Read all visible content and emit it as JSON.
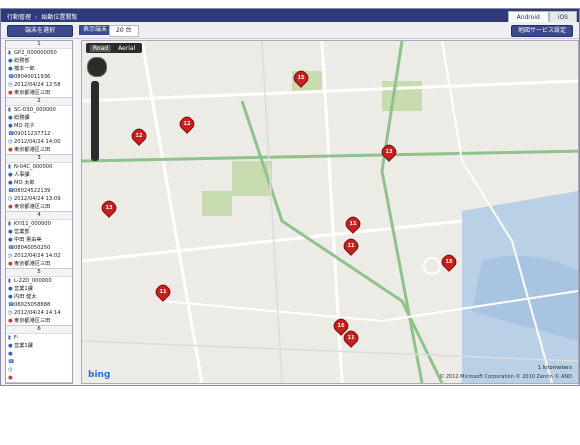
{
  "header": {
    "breadcrumb": [
      "行動管理",
      "始動位置閲覧"
    ],
    "tabs": [
      {
        "label": "Android",
        "active": true
      },
      {
        "label": "iOS",
        "active": false
      }
    ]
  },
  "toolbar": {
    "select_button": "端末を選択",
    "display_label": "表示端末",
    "display_value": "20 台",
    "settings_button": "地図サービス設定"
  },
  "devices": [
    {
      "num": "1",
      "id": "GP2_000000050",
      "dept": "総務部",
      "name": "橋本一郎",
      "phone": "08040011936",
      "time": "2012/04/24 12:58",
      "address": "東京都港区三田"
    },
    {
      "num": "2",
      "id": "SC-03D_000000",
      "dept": "総務課",
      "name": "MO 花子",
      "phone": "09011237712",
      "time": "2012/04/24 14:00",
      "address": "東京都港区三田"
    },
    {
      "num": "3",
      "id": "N-04C_000000",
      "dept": "人事課",
      "name": "MO 太郎",
      "phone": "08024522139",
      "time": "2012/04/24 13:09",
      "address": "東京都港区三田"
    },
    {
      "num": "4",
      "id": "KYI11_000000",
      "dept": "営業部",
      "name": "中田 憲由美",
      "phone": "08040050250",
      "time": "2012/04/24 14:02",
      "address": "東京都港区三田"
    },
    {
      "num": "5",
      "id": "L-22D_000000",
      "dept": "営業1課",
      "name": "内田 健太",
      "phone": "08025058888",
      "time": "2012/04/24 14:14",
      "address": "東京都港区三田"
    },
    {
      "num": "6",
      "id": "F-",
      "dept": "営業1課",
      "name": "",
      "phone": "",
      "time": "",
      "address": ""
    }
  ],
  "map": {
    "view_road": "Road",
    "view_aerial": "Aerial",
    "scale": "1 kilometers",
    "copyright": "© 2012 Microsoft Corporation  © 2010 Zenrin  © AND",
    "logo": "bing",
    "pins": [
      "15",
      "12",
      "12",
      "13",
      "13",
      "11",
      "11",
      "15",
      "11",
      "16",
      "11"
    ]
  }
}
